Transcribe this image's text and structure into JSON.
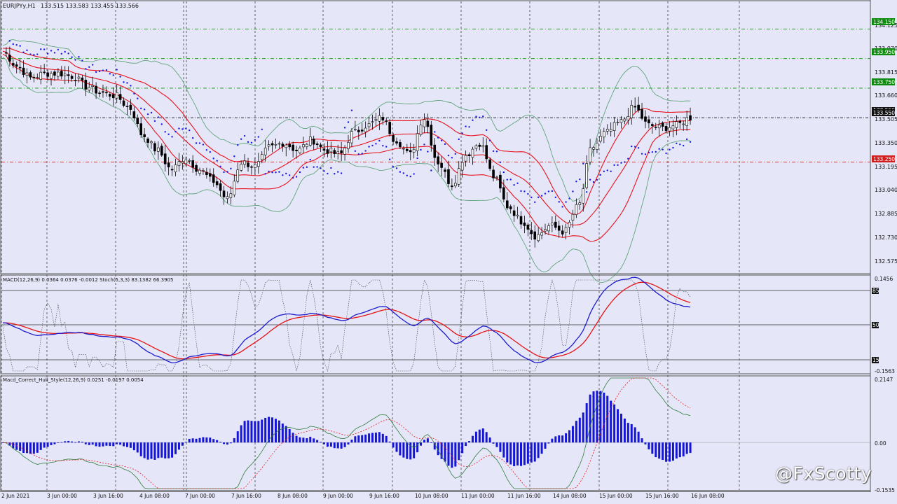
{
  "header": {
    "symbol": "EURJPYy,H1",
    "ohlc": "133.515 133.583 133.455 133.566"
  },
  "colors": {
    "background": "#e6e6f9",
    "candle_up": "#ffffff",
    "candle_down": "#000000",
    "ma": "#e8111b",
    "bollinger": "#5fa67a",
    "psar": "#1a1ae6",
    "macd_main": "#1c1ccc",
    "macd_signal": "#e41414",
    "stoch": "#444444",
    "hull_hist": "#1515d6",
    "hull_line": "#2e7d3a",
    "hull_signal": "#e02020",
    "level_green": "#0e8a0e",
    "level_red": "#d41e1e"
  },
  "main_panel": {
    "price_ticks": [
      "134.125",
      "133.970",
      "133.815",
      "133.660",
      "133.505",
      "133.350",
      "133.195",
      "133.040",
      "132.885",
      "132.730",
      "132.575"
    ],
    "levels": [
      {
        "label": "134.150",
        "price": 134.15,
        "style": "green"
      },
      {
        "label": "133.950",
        "price": 133.95,
        "style": "green"
      },
      {
        "label": "133.750",
        "price": 133.75,
        "style": "green"
      },
      {
        "label": "133.550",
        "price": 133.55,
        "style": "black"
      },
      {
        "label": "133.250",
        "price": 133.25,
        "style": "red"
      }
    ],
    "current_price_label": "133.566"
  },
  "macd_panel": {
    "label": "MACD(12,26,9) 0.0364 0.0376 -0.0012  Stoch(5,3,3) 83.1382 66.3905",
    "ticks": {
      "top": "0.1456",
      "level85": "85",
      "level50": "50",
      "level15": "15",
      "bottom": "-0.1563"
    }
  },
  "hull_panel": {
    "label": "Macd_Correct_Hull_Style(12,26,9) 0.0251 -0.0197 0.0054",
    "ticks": {
      "top": "0.2147",
      "zero": "0.00",
      "bottom": "-0.1535"
    }
  },
  "time_axis": [
    "2 Jun 2021",
    "3 Jun 00:00",
    "3 Jun 16:00",
    "4 Jun 08:00",
    "7 Jun 00:00",
    "7 Jun 16:00",
    "8 Jun 08:00",
    "9 Jun 00:00",
    "9 Jun 16:00",
    "10 Jun 08:00",
    "11 Jun 00:00",
    "11 Jun 16:00",
    "14 Jun 08:00",
    "15 Jun 00:00",
    "15 Jun 16:00",
    "16 Jun 08:00"
  ],
  "watermark": "@FxScotty",
  "chart_data": {
    "type": "line",
    "title": "EURJPYy,H1",
    "y_range": [
      132.5,
      134.28
    ],
    "anchors": [
      [
        0,
        134.0
      ],
      [
        2,
        133.9
      ],
      [
        4,
        133.82
      ],
      [
        6,
        133.85
      ],
      [
        8,
        133.85
      ],
      [
        10,
        133.83
      ],
      [
        12,
        133.76
      ],
      [
        14,
        133.72
      ],
      [
        16,
        133.7
      ],
      [
        18,
        133.62
      ],
      [
        20,
        133.43
      ],
      [
        22,
        133.33
      ],
      [
        24,
        133.2
      ],
      [
        26,
        133.28
      ],
      [
        28,
        133.2
      ],
      [
        30,
        133.12
      ],
      [
        32,
        133.0
      ],
      [
        34,
        133.25
      ],
      [
        36,
        133.22
      ],
      [
        38,
        133.35
      ],
      [
        40,
        133.38
      ],
      [
        42,
        133.33
      ],
      [
        44,
        133.4
      ],
      [
        46,
        133.33
      ],
      [
        48,
        133.3
      ],
      [
        50,
        133.45
      ],
      [
        52,
        133.5
      ],
      [
        54,
        133.55
      ],
      [
        56,
        133.4
      ],
      [
        58,
        133.3
      ],
      [
        60,
        133.55
      ],
      [
        62,
        133.25
      ],
      [
        64,
        133.1
      ],
      [
        66,
        133.3
      ],
      [
        68,
        133.38
      ],
      [
        70,
        133.15
      ],
      [
        72,
        132.95
      ],
      [
        74,
        132.85
      ],
      [
        76,
        132.75
      ],
      [
        78,
        132.82
      ],
      [
        80,
        132.78
      ],
      [
        82,
        132.95
      ],
      [
        84,
        133.35
      ],
      [
        86,
        133.45
      ],
      [
        88,
        133.52
      ],
      [
        90,
        133.62
      ],
      [
        92,
        133.5
      ],
      [
        94,
        133.48
      ],
      [
        96,
        133.5
      ],
      [
        98,
        133.55
      ]
    ]
  }
}
